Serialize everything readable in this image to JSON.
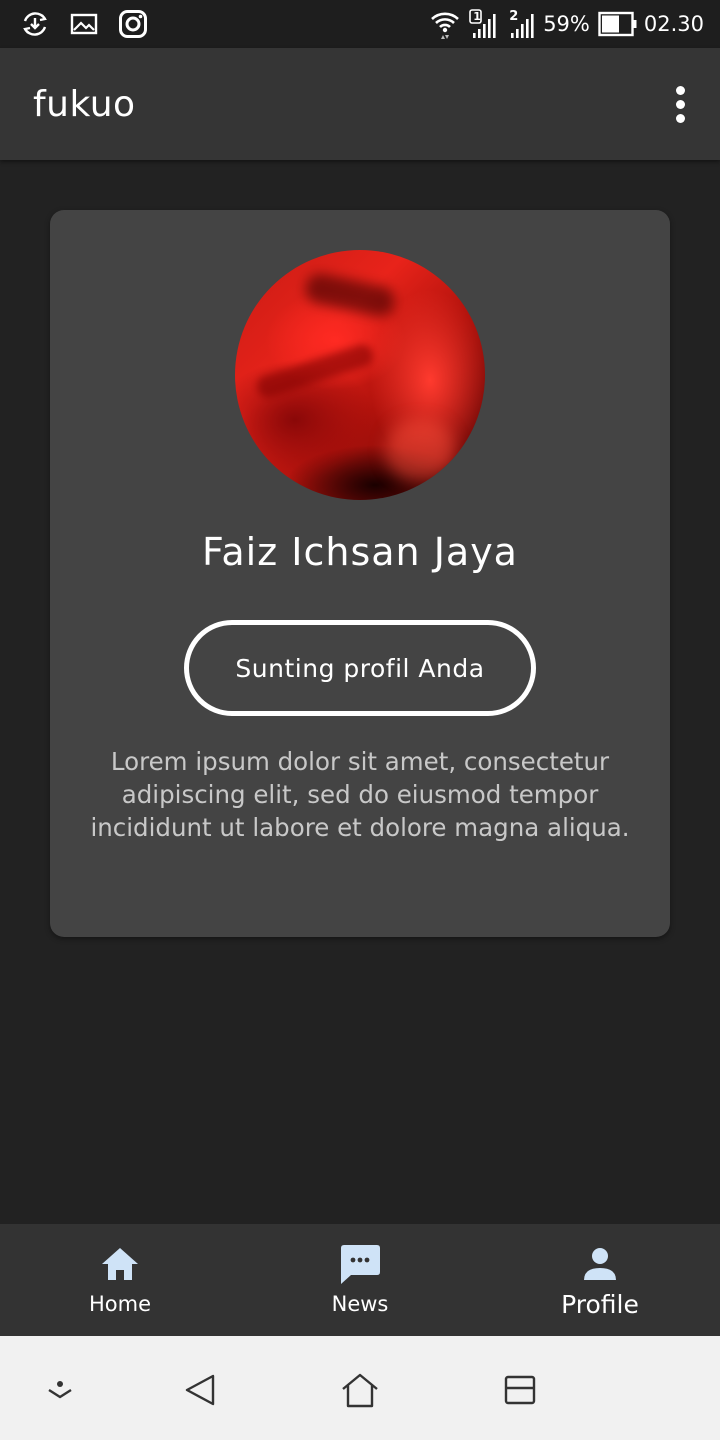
{
  "status_bar": {
    "battery_percent": "59%",
    "time": "02.30",
    "sim1_label": "1",
    "sim2_label": "2",
    "icons_left": [
      "download-sync-icon",
      "gallery-icon",
      "instagram-icon"
    ],
    "icons_right": [
      "wifi-icon",
      "signal-sim1-icon",
      "signal-sim2-icon",
      "battery-icon"
    ]
  },
  "app_bar": {
    "title": "fukuo",
    "menu_icon": "more-vert-icon"
  },
  "profile": {
    "name": "Faiz Ichsan Jaya",
    "edit_button_label": "Sunting profil Anda",
    "bio": "Lorem ipsum dolor sit amet, consectetur adipiscing elit, sed do eiusmod tempor incididunt ut labore et dolore magna aliqua."
  },
  "bottom_nav": {
    "items": [
      {
        "label": "Home",
        "icon": "home-icon",
        "active": false
      },
      {
        "label": "News",
        "icon": "chat-bubble-icon",
        "active": false
      },
      {
        "label": "Profile",
        "icon": "person-icon",
        "active": true
      }
    ],
    "icon_color": "#cfe3f7"
  },
  "system_nav": {
    "icons": [
      "hide-nav-icon",
      "back-icon",
      "home-outline-icon",
      "recents-icon"
    ]
  },
  "colors": {
    "background": "#222222",
    "app_bar": "#353535",
    "card": "#444444",
    "bottom_nav": "#333333",
    "system_nav": "#f1f1f1"
  }
}
